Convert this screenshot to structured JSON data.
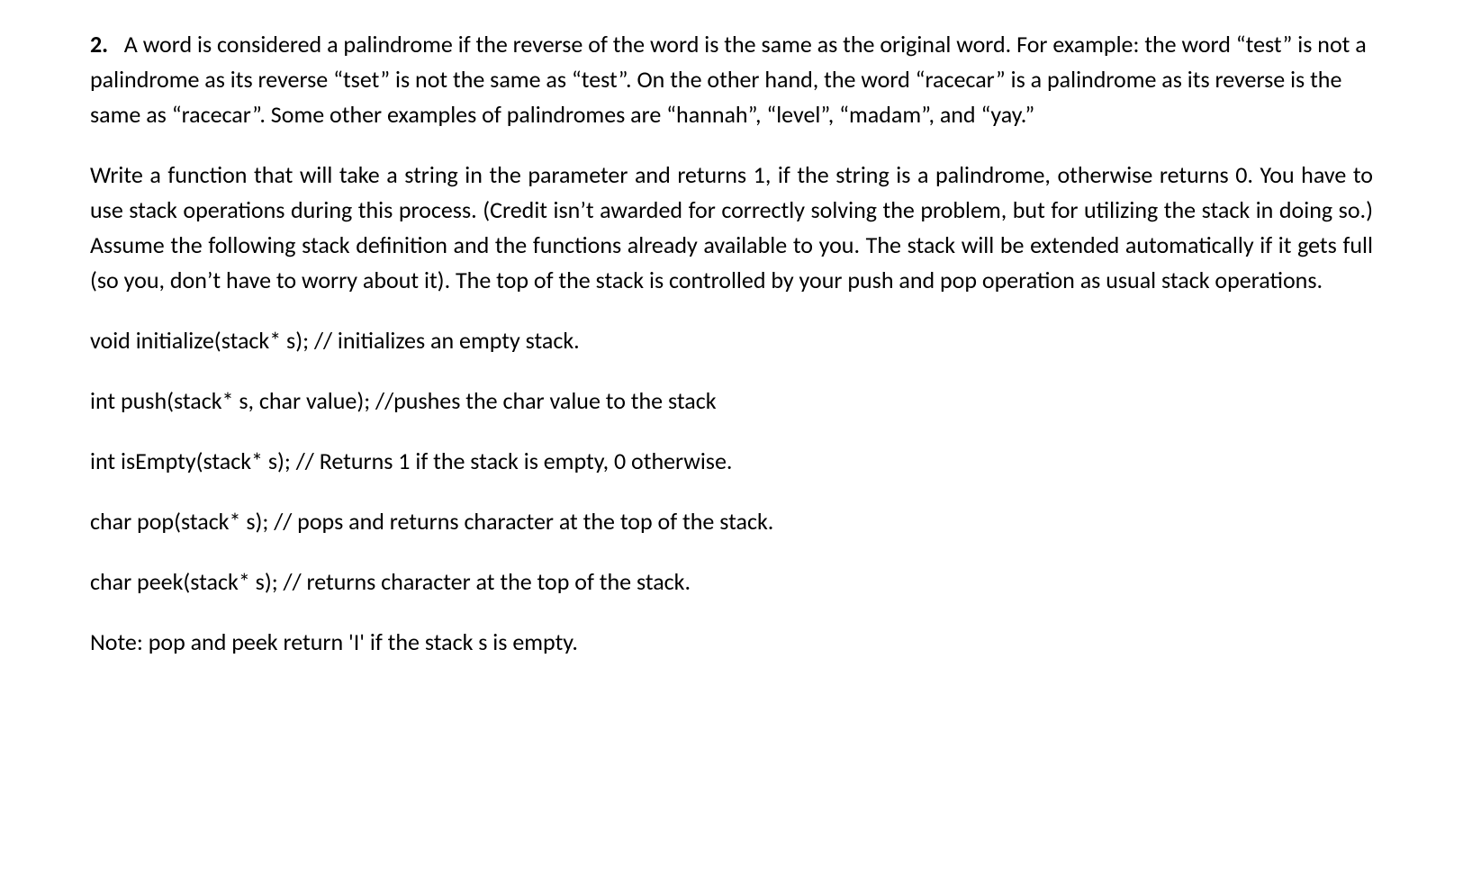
{
  "question": {
    "number": "2.",
    "para1": "A word is considered a palindrome if the reverse of the word is the same as the original word. For example: the word “test” is not a palindrome as its reverse “tset” is not the same as “test”. On the other hand, the word “racecar” is a palindrome as its reverse is the same as “racecar”. Some other examples of palindromes are “hannah”, “level”, “madam”, and “yay.”",
    "para2": "Write a function that will take a string in the parameter and returns 1, if the string is a palindrome, otherwise returns 0. You have to use stack operations during this process. (Credit isn’t awarded for correctly solving the problem, but for utilizing the stack in doing so.) Assume the following stack definition and the functions already available to you. The stack will be extended automatically if it gets full (so you, don’t have to worry about it). The top of the stack is controlled by your push and pop operation as usual stack operations.",
    "code_lines": [
      "void initialize(stack* s); // initializes an empty stack.",
      "int push(stack* s, char value); //pushes the char value to the stack",
      "int isEmpty(stack* s); // Returns 1 if the stack is empty, 0 otherwise.",
      "char pop(stack* s); // pops and returns character at the top of the stack.",
      "char peek(stack* s); // returns character at the top of the stack."
    ],
    "note": "Note: pop and peek return 'I' if the stack s is empty."
  }
}
